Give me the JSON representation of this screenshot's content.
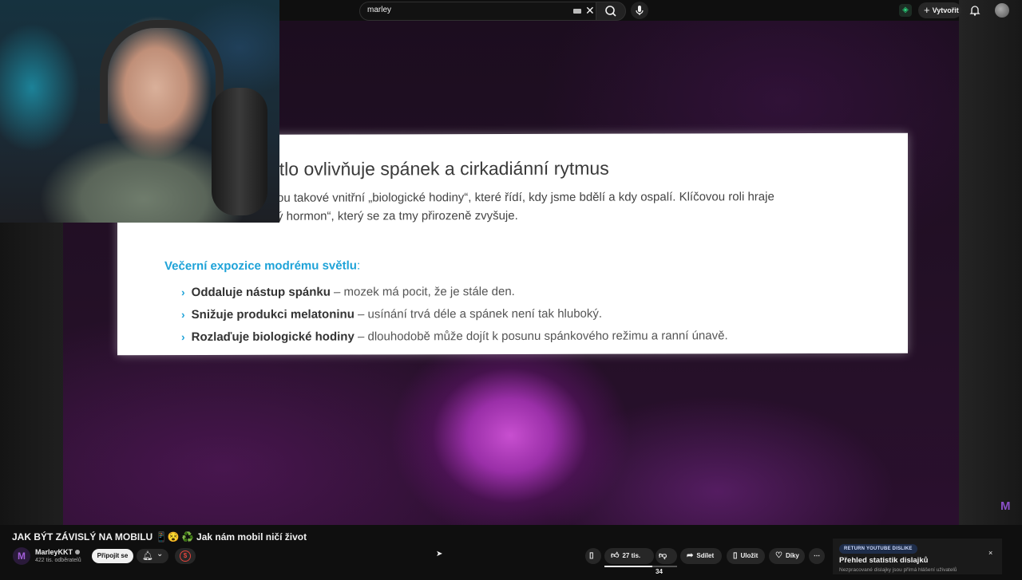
{
  "search": {
    "query": "marley"
  },
  "header": {
    "create_label": "Vytvořit"
  },
  "slide": {
    "title": "ětlo ovlivňuje spánek a cirkadiánní rytmus",
    "text_line1": "ou takové vnitřní „biologické hodiny“, které řídí, kdy jsme bdělí a kdy ospalí. Klíčovou roli hraje",
    "text_line2": "ý hormon“, který se za tmy přirozeně zvyšuje.",
    "subheading": "Večerní expozice modrému světlu",
    "subheading_colon": ":",
    "bullets": [
      {
        "bold": "Oddaluje nástup spánku",
        "rest": " – mozek má pocit, že je stále den."
      },
      {
        "bold": "Snižuje produkci melatoninu",
        "rest": " – usínání trvá déle a spánek není tak hluboký."
      },
      {
        "bold": "Rozlaďuje biologické hodiny",
        "rest": " – dlouhodobě může dojít k posunu spánkového režimu a ranní únavě."
      }
    ]
  },
  "video": {
    "title": "JAK BÝT ZÁVISLÝ NA MOBILU 📱😵 ♻️ Jak nám mobil ničí život",
    "watermark": "M"
  },
  "channel": {
    "avatar_letter": "M",
    "name": "MarleyKKT",
    "subscribers": "422 tis. odběratelů",
    "join_label": "Připojit se"
  },
  "actions": {
    "likes": "27 tis.",
    "like_ratio": 0.66,
    "dislikes": "34",
    "share": "Sdílet",
    "save": "Uložit",
    "thanks": "Díky",
    "more": "⋯"
  },
  "rdy": {
    "badge": "RETURN YOUTUBE DISLIKE",
    "title": "Přehled statistik dislajků",
    "subtitle": "Nezpracované dislajky jsou přímá hlášení uživatelů",
    "close": "×"
  }
}
